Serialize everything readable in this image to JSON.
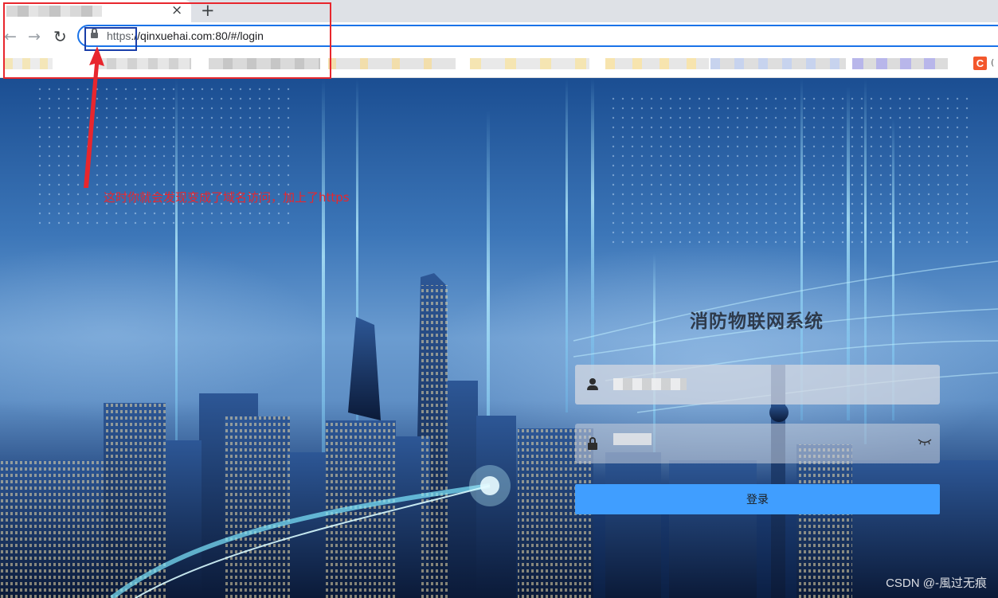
{
  "browser": {
    "close_glyph": "×",
    "new_tab_glyph": "+",
    "back_glyph": "←",
    "forward_glyph": "→",
    "reload_glyph": "↻",
    "url_scheme": "https",
    "url_rest": "://qinxuehai.com:80/#/login",
    "csdn_favicon_letter": "C",
    "bookmark_tail": "("
  },
  "login": {
    "title": "消防物联网系统",
    "button_label": "登录"
  },
  "annotation": {
    "text": "这时你就会发现变成了域名访问，加上了https",
    "color": "#e8262d"
  },
  "watermark": "CSDN @-風过无痕",
  "colors": {
    "accent": "#409eff",
    "omnibox_border": "#1a73e8"
  }
}
